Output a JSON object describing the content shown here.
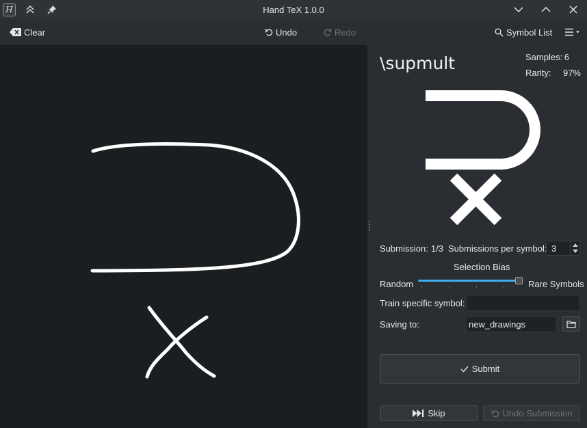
{
  "window": {
    "title": "Hand TeX 1.0.0",
    "logo_letter": "H"
  },
  "toolbar": {
    "clear_label": "Clear",
    "undo_label": "Undo",
    "redo_label": "Redo",
    "symbol_list_label": "Symbol List"
  },
  "panel": {
    "symbol_command": "\\supmult",
    "samples_label": "Samples:",
    "samples_value": "6",
    "rarity_label": "Rarity:",
    "rarity_value": "97%",
    "submission_label": "Submission:",
    "submission_value": "1/3",
    "per_symbol_label": "Submissions per symbol:",
    "per_symbol_value": "3",
    "selection_bias_label": "Selection Bias",
    "bias_left_label": "Random",
    "bias_right_label": "Rare Symbols",
    "bias_level_fraction": 0.95,
    "train_specific_label": "Train specific symbol:",
    "train_specific_value": "",
    "saving_to_label": "Saving to:",
    "saving_to_value": "new_drawings",
    "submit_label": "Submit",
    "skip_label": "Skip",
    "undo_submission_label": "Undo Submission"
  },
  "colors": {
    "accent": "#3daee9",
    "canvas_bg": "#1b1e20",
    "window_bg": "#2a2e32",
    "stroke": "#ffffff"
  }
}
